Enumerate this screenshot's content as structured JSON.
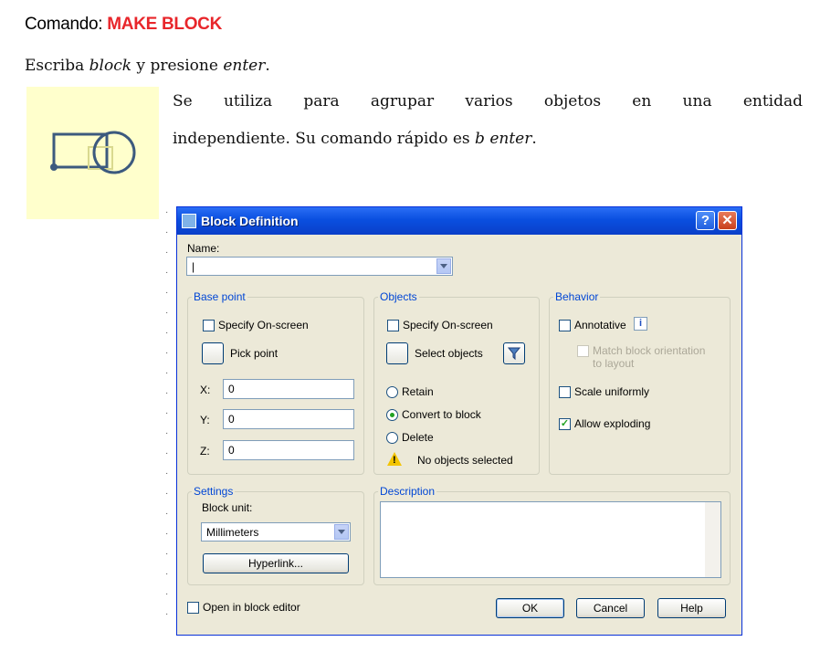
{
  "doc": {
    "heading_prefix": "Comando: ",
    "heading_command": "MAKE BLOCK",
    "instr_1": "Escriba ",
    "instr_block": "block",
    "instr_2": " y presione ",
    "instr_enter": "enter",
    "instr_3": ".",
    "para_line1": "Se utiliza para agrupar varios objetos en una entidad",
    "para_line2a": "independiente. Su comando rápido es ",
    "para_line2b": "b enter",
    "para_line2c": "."
  },
  "dialog": {
    "title": "Block Definition",
    "help_label": "?",
    "close_label": "✕",
    "name_label": "Name:",
    "name_value": "|",
    "base_point": {
      "legend": "Base point",
      "specify_label": "Specify On-screen",
      "pick_label": "Pick point",
      "x_label": "X:",
      "x_value": "0",
      "y_label": "Y:",
      "y_value": "0",
      "z_label": "Z:",
      "z_value": "0"
    },
    "objects": {
      "legend": "Objects",
      "specify_label": "Specify On-screen",
      "select_label": "Select objects",
      "retain_label": "Retain",
      "convert_label": "Convert to block",
      "delete_label": "Delete",
      "status": "No objects selected"
    },
    "behavior": {
      "legend": "Behavior",
      "annotative_label": "Annotative",
      "info_label": "i",
      "match_label_1": "Match block orientation",
      "match_label_2": "to layout",
      "scale_label": "Scale uniformly",
      "explode_label": "Allow exploding",
      "explode_checked": "✓"
    },
    "settings": {
      "legend": "Settings",
      "unit_label": "Block unit:",
      "unit_value": "Millimeters",
      "hyperlink_label": "Hyperlink..."
    },
    "description": {
      "legend": "Description"
    },
    "open_editor_label": "Open in block editor",
    "ok_label": "OK",
    "cancel_label": "Cancel",
    "help_button_label": "Help"
  },
  "colors": {
    "command_red": "#e8262b",
    "titlebar_blue": "#0a4fe0",
    "icon_bg": "#ffffcc"
  }
}
